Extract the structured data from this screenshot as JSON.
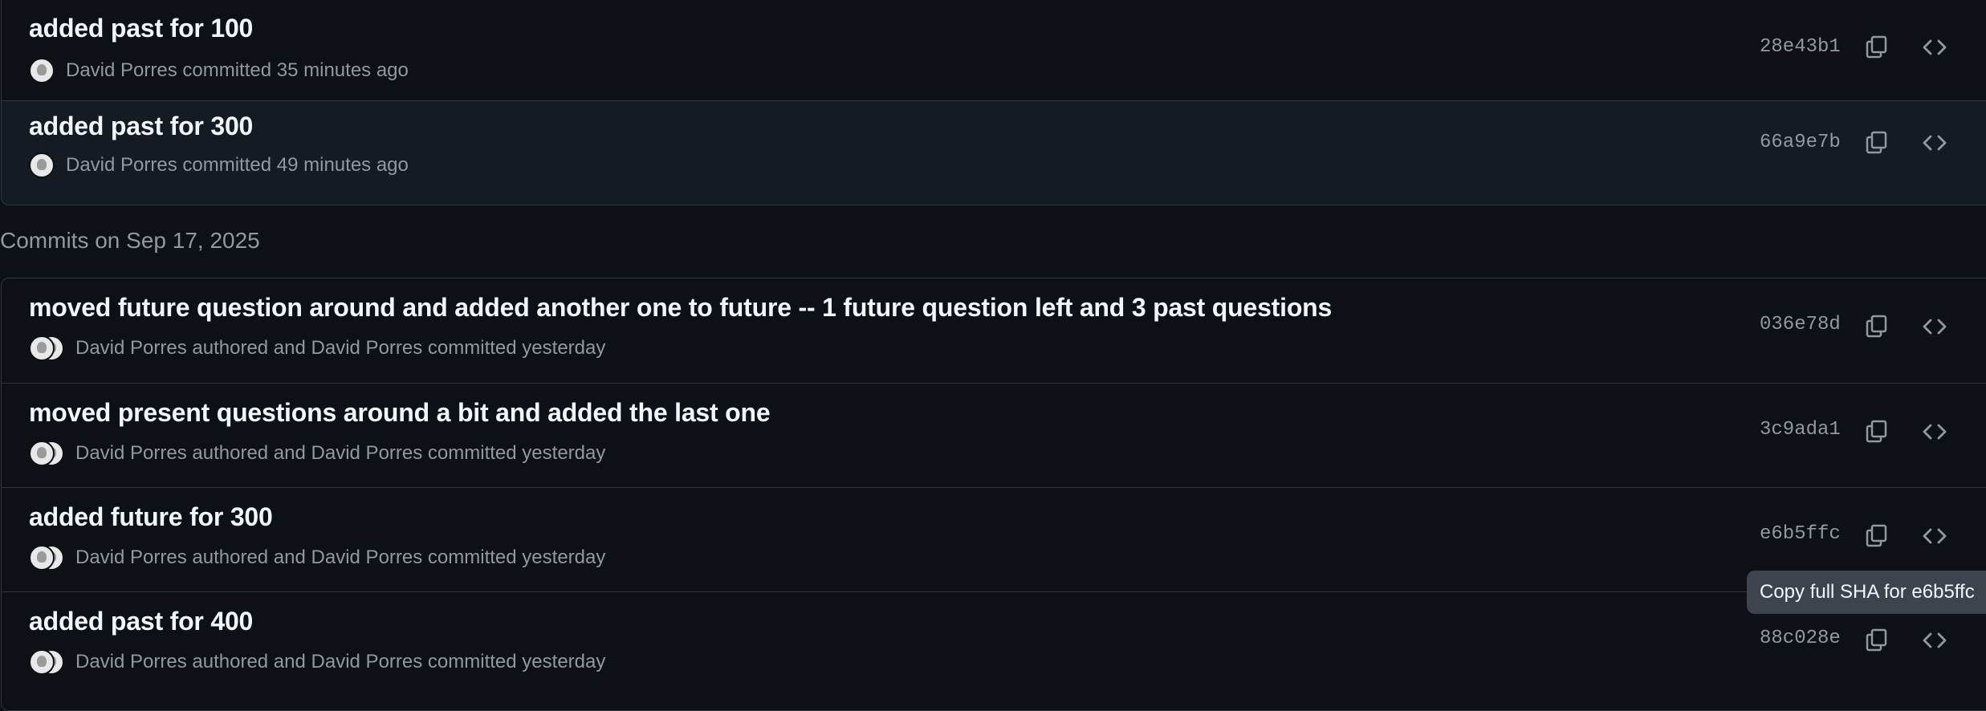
{
  "groups": [
    {
      "commits": [
        {
          "title": "added past for 100",
          "author": "David Porres",
          "action": "committed",
          "time": "35 minutes ago",
          "sha": "28e43b1"
        },
        {
          "title": "added past for 300",
          "author": "David Porres",
          "action": "committed",
          "time": "49 minutes ago",
          "sha": "66a9e7b"
        }
      ]
    },
    {
      "header": "Commits on Sep 17, 2025",
      "commits": [
        {
          "title": "moved future question around and added another one to future -- 1 future question left and 3 past questions",
          "author": "David Porres",
          "action": "authored and",
          "committer": "David Porres",
          "committed": "committed",
          "time": "yesterday",
          "sha": "036e78d"
        },
        {
          "title": "moved present questions around a bit and added the last one",
          "author": "David Porres",
          "action": "authored and",
          "committer": "David Porres",
          "committed": "committed",
          "time": "yesterday",
          "sha": "3c9ada1"
        },
        {
          "title": "added future for 300",
          "author": "David Porres",
          "action": "authored and",
          "committer": "David Porres",
          "committed": "committed",
          "time": "yesterday",
          "sha": "e6b5ffc"
        },
        {
          "title": "added past for 400",
          "author": "David Porres",
          "action": "authored and",
          "committer": "David Porres",
          "committed": "committed",
          "time": "yesterday",
          "sha": "88c028e"
        }
      ]
    }
  ],
  "tooltip": "Copy full SHA for e6b5ffc",
  "icons": {
    "copy": "copy-icon",
    "code": "code-icon",
    "avatar": "avatar"
  },
  "colors": {
    "background": "#0d1117",
    "row_hover": "#151b23",
    "border": "#30363d",
    "muted_text": "#9198a1",
    "title_text": "#f0f6fc",
    "tooltip_bg": "#3d444d"
  }
}
